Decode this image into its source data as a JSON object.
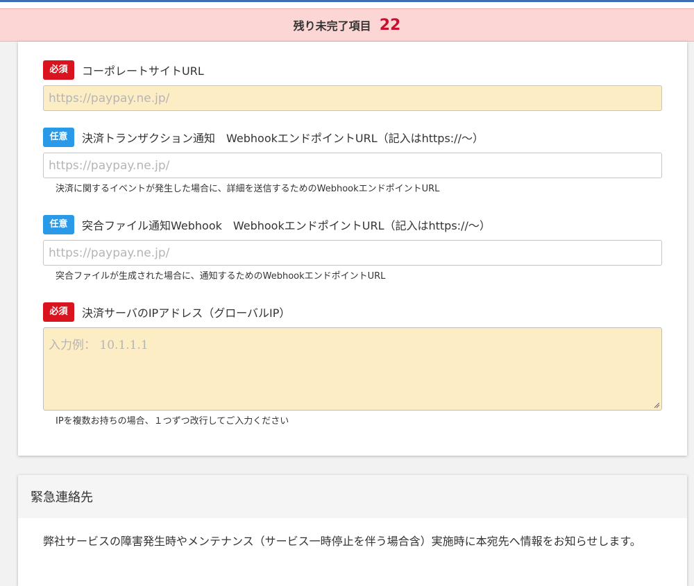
{
  "banner": {
    "label": "残り未完了項目",
    "count": "22"
  },
  "fields": [
    {
      "badge": "必須",
      "label": "コーポレートサイトURL",
      "placeholder": "https://paypay.ne.jp/",
      "help": ""
    },
    {
      "badge": "任意",
      "label": "決済トランザクション通知　WebhookエンドポイントURL（記入はhttps://～）",
      "placeholder": "https://paypay.ne.jp/",
      "help": "決済に関するイベントが発生した場合に、詳細を送信するためのWebhookエンドポイントURL"
    },
    {
      "badge": "任意",
      "label": "突合ファイル通知Webhook　WebhookエンドポイントURL（記入はhttps://～）",
      "placeholder": "https://paypay.ne.jp/",
      "help": "突合ファイルが生成された場合に、通知するためのWebhookエンドポイントURL"
    },
    {
      "badge": "必須",
      "label": "決済サーバのIPアドレス（グローバルIP）",
      "placeholder": "入力例： 10.1.1.1",
      "help": "IPを複数お持ちの場合、１つずつ改行してご入力ください"
    }
  ],
  "emergency": {
    "title": "緊急連絡先",
    "body": "弊社サービスの障害発生時やメンテナンス（サービス一時停止を伴う場合含）実施時に本宛先へ情報をお知らせします。"
  },
  "colors": {
    "required": "#d9141e",
    "optional": "#2a9ae8",
    "required_bg": "#fdedc4",
    "banner_bg": "#fbd6d5",
    "count": "#c8102e"
  }
}
